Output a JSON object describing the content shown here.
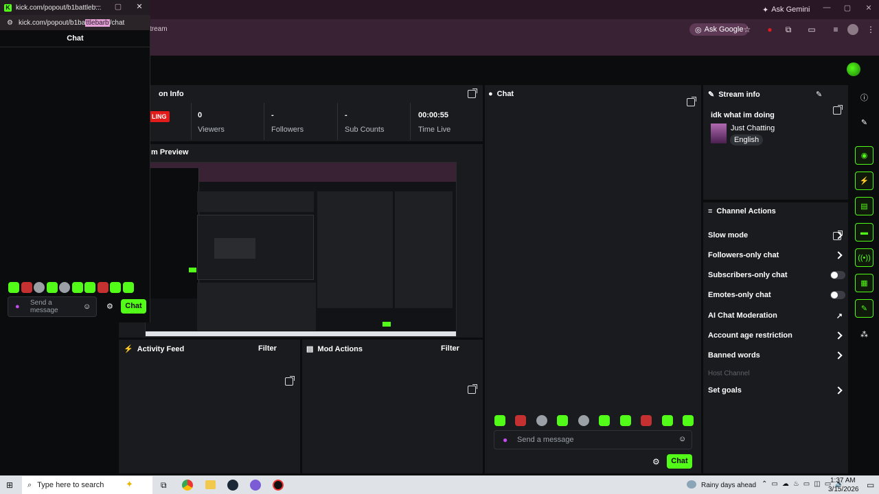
{
  "browser": {
    "ask_gemini": "Ask Gemini",
    "ask_google": "Ask Google",
    "crumb": "tream"
  },
  "popout": {
    "title": "kick.com/popout/b1battleb...",
    "url_prefix": "kick.com/popout/b1ba",
    "url_highlight": "ttlebarb",
    "url_suffix": "/chat",
    "header": "Chat",
    "input_placeholder": "Send a message",
    "chat_button": "Chat"
  },
  "session_info": {
    "title": "on Info",
    "live_badge": "LING",
    "stats": [
      {
        "value": "0",
        "label": "Viewers"
      },
      {
        "value": "-",
        "label": "Followers"
      },
      {
        "value": "-",
        "label": "Sub Counts"
      },
      {
        "value": "00:00:55",
        "label": "Time Live"
      }
    ]
  },
  "preview": {
    "title": "m Preview"
  },
  "chat": {
    "title": "Chat",
    "input_placeholder": "Send a message",
    "chat_button": "Chat"
  },
  "stream_info": {
    "title": "Stream info",
    "stream_title": "idk what im doing",
    "category": "Just Chatting",
    "language": "English"
  },
  "channel_actions": {
    "title": "Channel Actions",
    "items": [
      {
        "label": "Slow mode",
        "control": "chevron"
      },
      {
        "label": "Followers-only chat",
        "control": "chevron"
      },
      {
        "label": "Subscribers-only chat",
        "control": "toggle"
      },
      {
        "label": "Emotes-only chat",
        "control": "toggle"
      },
      {
        "label": "AI Chat Moderation",
        "control": "external"
      },
      {
        "label": "Account age restriction",
        "control": "chevron"
      },
      {
        "label": "Banned words",
        "control": "chevron"
      },
      {
        "label": "Host Channel",
        "control": "none",
        "disabled": true
      },
      {
        "label": "Set goals",
        "control": "chevron"
      }
    ]
  },
  "activity_feed": {
    "title": "Activity Feed",
    "filter": "Filter"
  },
  "mod_actions": {
    "title": "Mod Actions",
    "filter": "Filter"
  },
  "taskbar": {
    "search_placeholder": "Type here to search",
    "weather": "Rainy days ahead",
    "time": "1:37 AM",
    "date": "3/15/2026"
  },
  "colors": {
    "accent": "#53fc18",
    "panel": "#191b1f",
    "background": "#0b0c0d",
    "live": "#e21b1b"
  }
}
